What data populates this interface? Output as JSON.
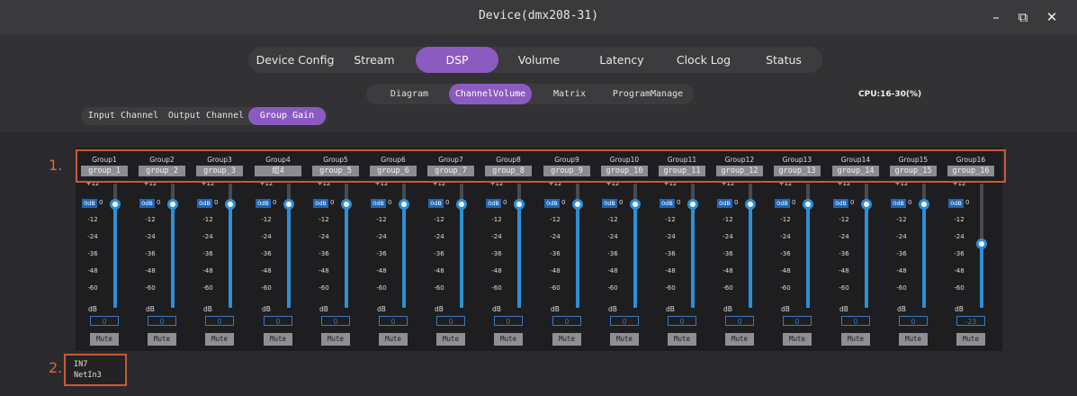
{
  "window": {
    "title": "Device(dmx208-31)",
    "minimize": "–",
    "restore": "⧉",
    "close": "✕"
  },
  "tabs": [
    "Device Config",
    "Stream",
    "DSP",
    "Volume",
    "Latency",
    "Clock Log",
    "Status"
  ],
  "active_tab": "DSP",
  "subtabs": [
    "Diagram",
    "ChannelVolume",
    "Matrix",
    "ProgramManage"
  ],
  "active_subtab": "ChannelVolume",
  "cpu": "CPU:16-30(%)",
  "channel_tabs": [
    "Input Channel",
    "Output Channel",
    "Group Gain"
  ],
  "active_channel_tab": "Group Gain",
  "scale": [
    "+12",
    "0",
    "-12",
    "-24",
    "-36",
    "-48",
    "-60"
  ],
  "odb_label": "0dB",
  "db_label": "dB",
  "mute_label": "Mute",
  "accent": "#8c5bc1",
  "fader_color": "#2d8fd6",
  "annotation_color": "#c85a3a",
  "groups": [
    {
      "title": "Group1",
      "name": "group_1",
      "gain_db": 0,
      "value": "0"
    },
    {
      "title": "Group2",
      "name": "group_2",
      "gain_db": 0,
      "value": "0"
    },
    {
      "title": "Group3",
      "name": "group_3",
      "gain_db": 0,
      "value": "0"
    },
    {
      "title": "Group4",
      "name": "组4",
      "gain_db": 0,
      "value": "0"
    },
    {
      "title": "Group5",
      "name": "group_5",
      "gain_db": 0,
      "value": "0"
    },
    {
      "title": "Group6",
      "name": "group_6",
      "gain_db": 0,
      "value": "0"
    },
    {
      "title": "Group7",
      "name": "group_7",
      "gain_db": 0,
      "value": "0"
    },
    {
      "title": "Group8",
      "name": "group_8",
      "gain_db": 0,
      "value": "0"
    },
    {
      "title": "Group9",
      "name": "group_9",
      "gain_db": 0,
      "value": "0"
    },
    {
      "title": "Group10",
      "name": "group_10",
      "gain_db": 0,
      "value": "0"
    },
    {
      "title": "Group11",
      "name": "group_11",
      "gain_db": 0,
      "value": "0"
    },
    {
      "title": "Group12",
      "name": "group_12",
      "gain_db": 0,
      "value": "0"
    },
    {
      "title": "Group13",
      "name": "group_13",
      "gain_db": 0,
      "value": "0"
    },
    {
      "title": "Group14",
      "name": "group_14",
      "gain_db": 0,
      "value": "0"
    },
    {
      "title": "Group15",
      "name": "group_15",
      "gain_db": 0,
      "value": "0"
    },
    {
      "title": "Group16",
      "name": "group_16",
      "gain_db": -23,
      "value": "-23"
    }
  ],
  "source": {
    "line1": "IN7",
    "line2": "NetIn3"
  },
  "annotations": [
    "1.",
    "2."
  ]
}
